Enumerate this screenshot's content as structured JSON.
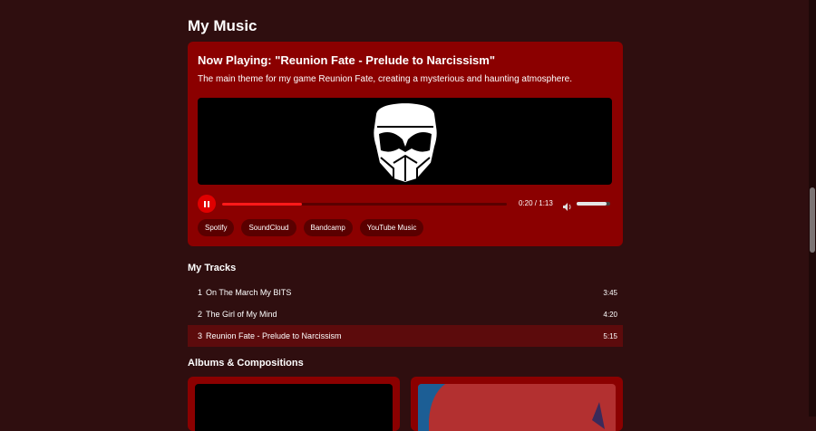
{
  "page": {
    "title": "My Music"
  },
  "player": {
    "now_playing": "Now Playing: \"Reunion Fate - Prelude to Narcissism\"",
    "description": "The main theme for my game Reunion Fate, creating a mysterious and haunting atmosphere.",
    "current_time": "0:20",
    "separator": " / ",
    "total_time": "1:13",
    "progress_fraction": 0.28,
    "volume_fraction": 0.9,
    "state": "playing",
    "platforms": [
      "Spotify",
      "SoundCloud",
      "Bandcamp",
      "YouTube Music"
    ]
  },
  "tracks": {
    "title": "My Tracks",
    "items": [
      {
        "num": "1",
        "name": "On The March My BITS",
        "duration": "3:45",
        "active": false
      },
      {
        "num": "2",
        "name": "The Girl of My Mind",
        "duration": "4:20",
        "active": false
      },
      {
        "num": "3",
        "name": "Reunion Fate - Prelude to Narcissism",
        "duration": "5:15",
        "active": true
      }
    ]
  },
  "albums": {
    "title": "Albums & Compositions"
  },
  "colors": {
    "background": "#2f0e0f",
    "card": "#8b0000",
    "accent": "#e00000",
    "button": "#5a0000",
    "active_row": "#5c0b0c"
  },
  "icons": {
    "pause": "pause-icon",
    "volume": "volume-icon",
    "art": "helmet-mask-logo"
  }
}
